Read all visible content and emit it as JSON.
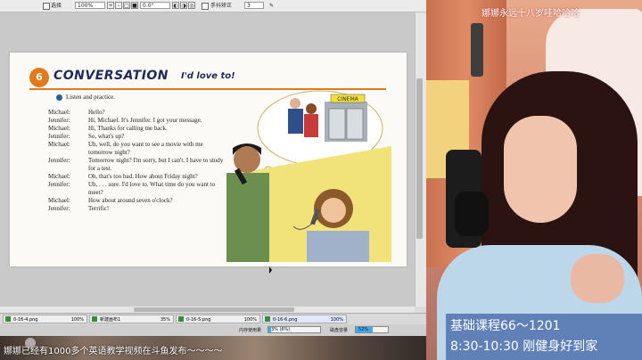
{
  "toolbar": {
    "select_label": "选择",
    "zoom_value": "100%",
    "zoom_buttons": [
      "+",
      "-",
      "□",
      "■"
    ],
    "rotation_value": "0.0°",
    "rotate_buttons": [
      "◐",
      "◑",
      "◎"
    ],
    "skew_label": "手抖矫正",
    "skew_value": "3",
    "skew_icon": "✎"
  },
  "lesson": {
    "number": "6",
    "title": "CONVERSATION",
    "subtitle": "I'd love to!",
    "instruction": "Listen and practice.",
    "dialog": [
      {
        "speaker": "Michael:",
        "text": "Hello?"
      },
      {
        "speaker": "Jennifer:",
        "text": "Hi, Michael. It's Jennifer. I got your message."
      },
      {
        "speaker": "Michael:",
        "text": "Hi, Thanks for calling me back."
      },
      {
        "speaker": "Jennifer:",
        "text": "So, what's up?"
      },
      {
        "speaker": "Michael:",
        "text": "Uh, well, do you want to see a movie with me tomorrow night?"
      },
      {
        "speaker": "Jennifer:",
        "text": "Tomorrow night? I'm sorry, but I can't. I have to study for a test."
      },
      {
        "speaker": "Michael:",
        "text": "Oh, that's too bad. How about Friday night?"
      },
      {
        "speaker": "Jennifer:",
        "text": "Uh, . . . sure. I'd love to. What time do you want to meet?"
      },
      {
        "speaker": "Michael:",
        "text": "How about around seven o'clock?"
      },
      {
        "speaker": "Jennifer:",
        "text": "Terrific!"
      }
    ],
    "cinema_sign": "CINEMA"
  },
  "file_tabs": [
    {
      "name": "0-16-4.png",
      "percent": "100%"
    },
    {
      "name": "新建画布1",
      "percent": "35%"
    },
    {
      "name": "0-16-5.png",
      "percent": "100%"
    },
    {
      "name": "0-16-6.png",
      "percent": "100%"
    }
  ],
  "memory": {
    "label": "内存使用量",
    "value": "3% (6%)",
    "fraction": 0.06,
    "disk_label": "磁盘容量",
    "disk_value": "52%",
    "disk_fraction": 0.52
  },
  "ticker": "娜娜已经有1000多个英语教学视频在斗鱼发布～～～～",
  "stream": {
    "title": "娜娜永远十八岁哇哈哈哈",
    "course_line1": "基础课程66～1201",
    "course_line2": "8:30-10:30  刚健身好到家"
  },
  "colors": {
    "badge": "#e07a1c",
    "title": "#1f2a5a",
    "memory_fill": "#3fa9f5",
    "course_banner": "#143c8c"
  }
}
